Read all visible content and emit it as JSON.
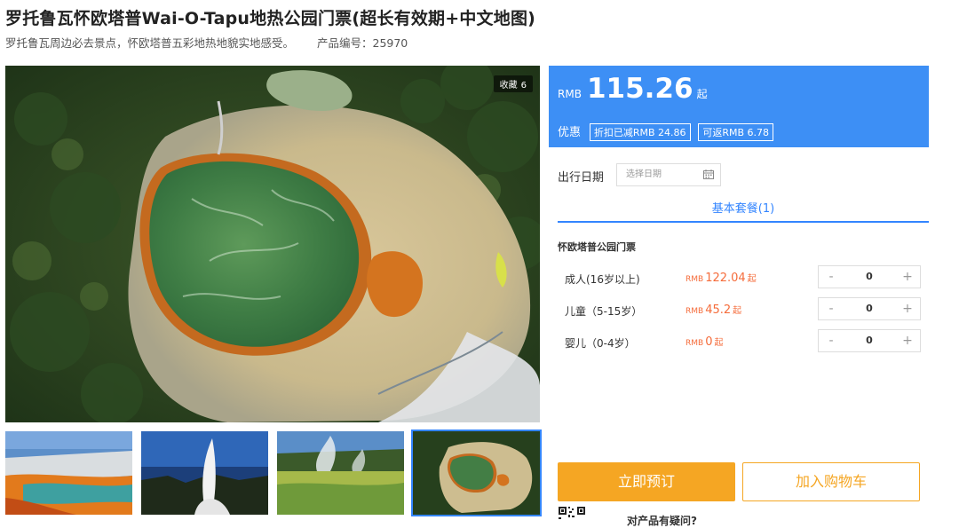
{
  "product": {
    "title": "罗托鲁瓦怀欧塔普Wai-O-Tapu地热公园门票(超长有效期+中文地图)",
    "subtitle": "罗托鲁瓦周边必去景点，怀欧塔普五彩地热地貌实地感受。",
    "code_label": "产品编号：25970"
  },
  "gallery": {
    "favorite_label": "收藏",
    "favorite_count": "6",
    "thumbnails": [
      {
        "icon": "thermal-pool-photo",
        "selected": false
      },
      {
        "icon": "geyser-photo",
        "selected": false
      },
      {
        "icon": "steaming-lake-photo",
        "selected": false
      },
      {
        "icon": "aerial-crater-photo",
        "selected": true
      }
    ]
  },
  "price": {
    "currency": "RMB",
    "amount": "115.26",
    "suffix": "起",
    "deal_label": "优惠",
    "tags": [
      "折扣已减RMB 24.86",
      "可返RMB 6.78"
    ],
    "background_color": "#3d8ff5"
  },
  "date": {
    "label": "出行日期",
    "placeholder": "选择日期"
  },
  "package_tab": "基本套餐(1)",
  "section_title": "怀欧塔普公园门票",
  "tickets": [
    {
      "name": "成人(16岁以上)",
      "currency": "RMB",
      "price": "122.04",
      "suffix": "起",
      "qty": "0",
      "minus": "-",
      "plus": "+"
    },
    {
      "name": "儿童（5-15岁）",
      "currency": "RMB",
      "price": "45.2",
      "suffix": "起",
      "qty": "0",
      "minus": "-",
      "plus": "+"
    },
    {
      "name": "婴儿（0-4岁）",
      "currency": "RMB",
      "price": "0",
      "suffix": "起",
      "qty": "0",
      "minus": "-",
      "plus": "+"
    }
  ],
  "actions": {
    "book": "立即预订",
    "cart": "加入购物车",
    "accent_color": "#f5a623"
  },
  "footer": {
    "question": "对产品有疑问?"
  }
}
